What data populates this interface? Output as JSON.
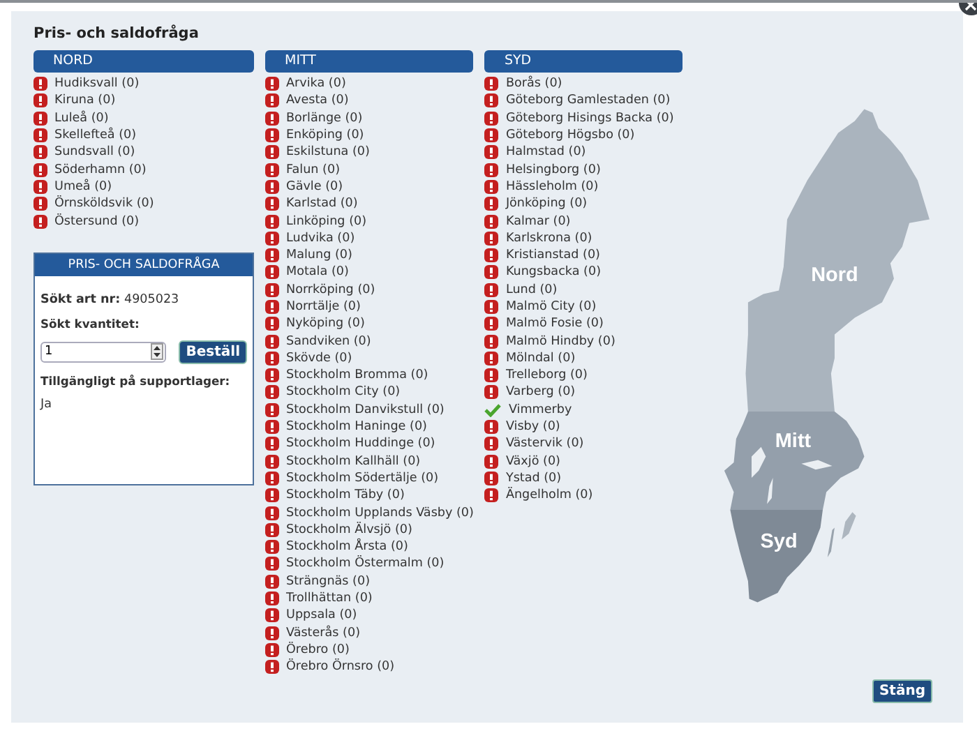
{
  "title": "Pris- och saldofråga",
  "regions": [
    {
      "name": "NORD",
      "stores": [
        {
          "name": "Hudiksvall (0)",
          "kind": "error"
        },
        {
          "name": "Kiruna (0)",
          "kind": "error"
        },
        {
          "name": "Luleå (0)",
          "kind": "error"
        },
        {
          "name": "Skellefteå (0)",
          "kind": "error"
        },
        {
          "name": "Sundsvall (0)",
          "kind": "error"
        },
        {
          "name": "Söderhamn (0)",
          "kind": "error"
        },
        {
          "name": "Umeå (0)",
          "kind": "error"
        },
        {
          "name": "Örnsköldsvik (0)",
          "kind": "error"
        },
        {
          "name": "Östersund (0)",
          "kind": "error"
        }
      ]
    },
    {
      "name": "MITT",
      "stores": [
        {
          "name": "Arvika (0)",
          "kind": "error"
        },
        {
          "name": "Avesta (0)",
          "kind": "error"
        },
        {
          "name": "Borlänge (0)",
          "kind": "error"
        },
        {
          "name": "Enköping (0)",
          "kind": "error"
        },
        {
          "name": "Eskilstuna (0)",
          "kind": "error"
        },
        {
          "name": "Falun (0)",
          "kind": "error"
        },
        {
          "name": "Gävle (0)",
          "kind": "error"
        },
        {
          "name": "Karlstad (0)",
          "kind": "error"
        },
        {
          "name": "Linköping (0)",
          "kind": "error"
        },
        {
          "name": "Ludvika (0)",
          "kind": "error"
        },
        {
          "name": "Malung (0)",
          "kind": "error"
        },
        {
          "name": "Motala (0)",
          "kind": "error"
        },
        {
          "name": "Norrköping (0)",
          "kind": "error"
        },
        {
          "name": "Norrtälje (0)",
          "kind": "error"
        },
        {
          "name": "Nyköping (0)",
          "kind": "error"
        },
        {
          "name": "Sandviken (0)",
          "kind": "error"
        },
        {
          "name": "Skövde (0)",
          "kind": "error"
        },
        {
          "name": "Stockholm Bromma (0)",
          "kind": "error"
        },
        {
          "name": "Stockholm City (0)",
          "kind": "error"
        },
        {
          "name": "Stockholm Danvikstull (0)",
          "kind": "error"
        },
        {
          "name": "Stockholm Haninge (0)",
          "kind": "error"
        },
        {
          "name": "Stockholm Huddinge (0)",
          "kind": "error"
        },
        {
          "name": "Stockholm Kallhäll (0)",
          "kind": "error"
        },
        {
          "name": "Stockholm Södertälje (0)",
          "kind": "error"
        },
        {
          "name": "Stockholm Täby (0)",
          "kind": "error"
        },
        {
          "name": "Stockholm Upplands Väsby (0)",
          "kind": "error"
        },
        {
          "name": "Stockholm Älvsjö (0)",
          "kind": "error"
        },
        {
          "name": "Stockholm Årsta (0)",
          "kind": "error"
        },
        {
          "name": "Stockholm Östermalm (0)",
          "kind": "error"
        },
        {
          "name": "Strängnäs (0)",
          "kind": "error"
        },
        {
          "name": "Trollhättan (0)",
          "kind": "error"
        },
        {
          "name": "Uppsala (0)",
          "kind": "error"
        },
        {
          "name": "Västerås (0)",
          "kind": "error"
        },
        {
          "name": "Örebro (0)",
          "kind": "error"
        },
        {
          "name": "Örebro Örnsro (0)",
          "kind": "error"
        }
      ]
    },
    {
      "name": "SYD",
      "stores": [
        {
          "name": "Borås (0)",
          "kind": "error"
        },
        {
          "name": "Göteborg Gamlestaden (0)",
          "kind": "error"
        },
        {
          "name": "Göteborg Hisings Backa (0)",
          "kind": "error"
        },
        {
          "name": "Göteborg Högsbo (0)",
          "kind": "error"
        },
        {
          "name": "Halmstad (0)",
          "kind": "error"
        },
        {
          "name": "Helsingborg (0)",
          "kind": "error"
        },
        {
          "name": "Hässleholm (0)",
          "kind": "error"
        },
        {
          "name": "Jönköping (0)",
          "kind": "error"
        },
        {
          "name": "Kalmar (0)",
          "kind": "error"
        },
        {
          "name": "Karlskrona (0)",
          "kind": "error"
        },
        {
          "name": "Kristianstad (0)",
          "kind": "error"
        },
        {
          "name": "Kungsbacka (0)",
          "kind": "error"
        },
        {
          "name": "Lund (0)",
          "kind": "error"
        },
        {
          "name": "Malmö City (0)",
          "kind": "error"
        },
        {
          "name": "Malmö Fosie (0)",
          "kind": "error"
        },
        {
          "name": "Malmö Hindby (0)",
          "kind": "error"
        },
        {
          "name": "Mölndal (0)",
          "kind": "error"
        },
        {
          "name": "Trelleborg (0)",
          "kind": "error"
        },
        {
          "name": "Varberg (0)",
          "kind": "error"
        },
        {
          "name": "Vimmerby",
          "kind": "ok"
        },
        {
          "name": "Visby (0)",
          "kind": "error"
        },
        {
          "name": "Västervik (0)",
          "kind": "error"
        },
        {
          "name": "Växjö (0)",
          "kind": "error"
        },
        {
          "name": "Ystad (0)",
          "kind": "error"
        },
        {
          "name": "Ängelholm (0)",
          "kind": "error"
        }
      ]
    }
  ],
  "info_box": {
    "title": "PRIS- OCH SALDOFRÅGA",
    "article": "**Sökt art nr:** 4905023",
    "quantity_label": "Sökt kvantitet:",
    "quantity": "1",
    "order_button": "Beställ",
    "availability_label": "Tillgängligt på supportlager:",
    "availability": "Ja"
  },
  "map": {
    "regions": [
      {
        "kind": "nord",
        "label": "Nord"
      },
      {
        "kind": "mitt",
        "label": "Mitt"
      },
      {
        "kind": "syd",
        "label": "Syd"
      }
    ]
  },
  "close_button": "Stäng"
}
